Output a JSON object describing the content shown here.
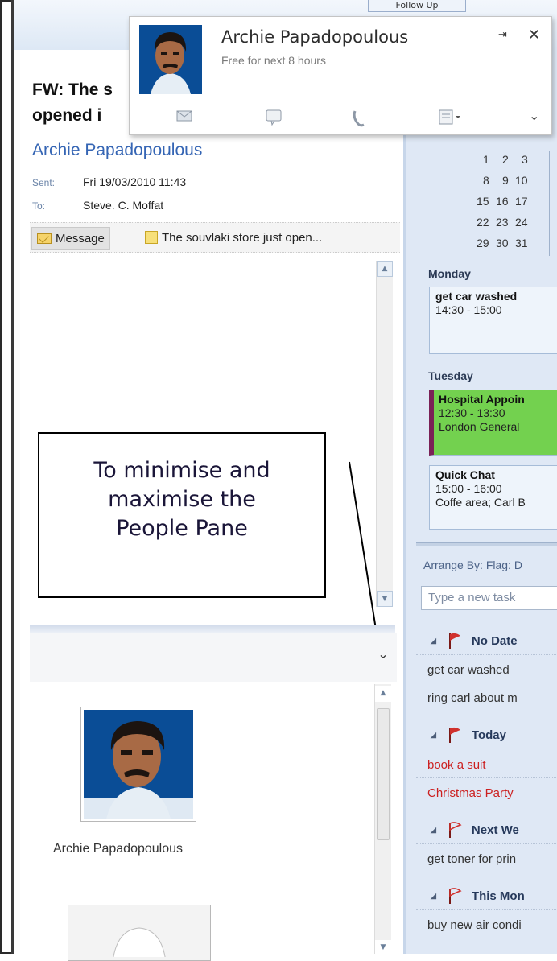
{
  "topband": {
    "tab_fragment": "Follow Up"
  },
  "contact_card": {
    "name": "Archie Papadopoulous",
    "status": "Free for next 8 hours",
    "pin_symbol": "⇥",
    "close_symbol": "✕",
    "more_symbol": "⌄",
    "actions": [
      "email-icon",
      "chat-icon",
      "phone-icon",
      "schedule-icon"
    ]
  },
  "message": {
    "subject_line1": "FW: The s",
    "subject_line2": "opened i",
    "sender": "Archie Papadopoulous",
    "sent_label": "Sent:",
    "sent_value": "Fri 19/03/2010 11:43",
    "to_label": "To:",
    "to_value": "Steve. C. Moffat",
    "attachments": [
      "Message",
      "The souvlaki store just open..."
    ]
  },
  "callout": {
    "line1": "To minimise and",
    "line2": "maximise the",
    "line3": "People Pane"
  },
  "people_pane": {
    "collapse_symbol": "⌄",
    "person_name": "Archie Papadopoulous"
  },
  "todo_bar": {
    "calendar_rows": [
      [
        "1",
        "2",
        "3"
      ],
      [
        "8",
        "9",
        "10"
      ],
      [
        "15",
        "16",
        "17"
      ],
      [
        "22",
        "23",
        "24"
      ],
      [
        "29",
        "30",
        "31"
      ]
    ],
    "days": [
      {
        "label": "Monday",
        "appointments": [
          {
            "title": "get car washed",
            "time": "14:30 - 15:00",
            "location": ""
          }
        ]
      },
      {
        "label": "Tuesday",
        "appointments": [
          {
            "title": "Hospital Appoin",
            "time": "12:30 - 13:30",
            "location": "London General"
          },
          {
            "title": "Quick Chat",
            "time": "15:00 - 16:00",
            "location": "Coffe area; Carl B"
          }
        ]
      }
    ],
    "arrange_by": "Arrange By: Flag: D",
    "new_task_placeholder": "Type a new task",
    "groups": [
      {
        "label": "No Date",
        "flag": "red",
        "tasks": [
          {
            "text": "get car washed",
            "overdue": false
          },
          {
            "text": "ring carl about m",
            "overdue": false
          }
        ]
      },
      {
        "label": "Today",
        "flag": "red",
        "tasks": [
          {
            "text": "book a suit",
            "overdue": true
          },
          {
            "text": "Christmas Party",
            "overdue": true
          }
        ]
      },
      {
        "label": "Next We",
        "flag": "outline",
        "tasks": [
          {
            "text": "get toner for prin",
            "overdue": false
          }
        ]
      },
      {
        "label": "This Mon",
        "flag": "outline",
        "tasks": [
          {
            "text": "buy new air condi",
            "overdue": false
          }
        ]
      }
    ]
  },
  "colors": {
    "accent_blue": "#3565b4",
    "overdue_red": "#cc2020",
    "appointment_green": "#73d14f",
    "flag_red": "#d0312d"
  }
}
